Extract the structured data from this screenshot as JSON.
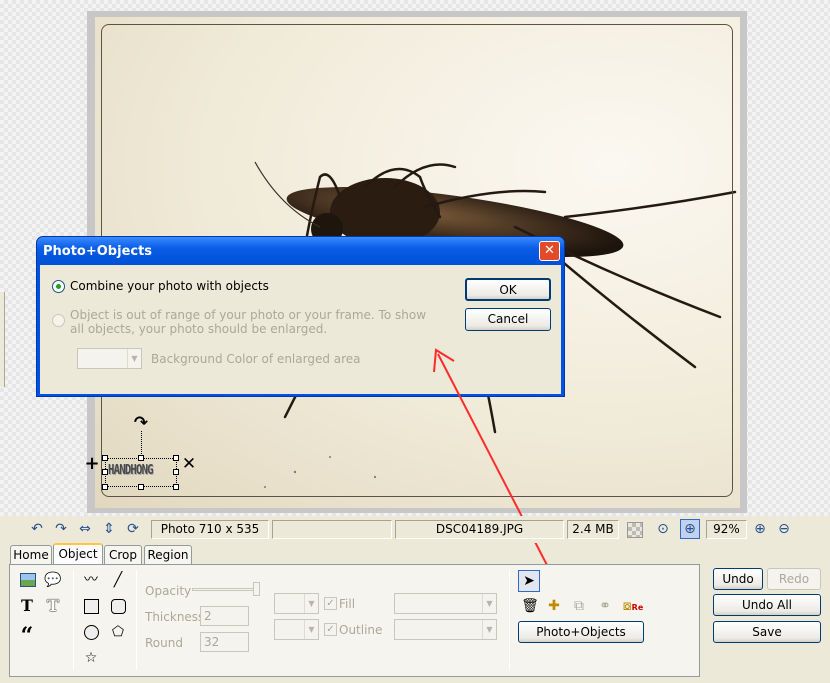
{
  "canvas": {
    "object_text": "HANDHONG"
  },
  "dialog": {
    "title": "Photo+Objects",
    "close_symbol": "✕",
    "option_combine": "Combine your photo with objects",
    "option_enlarge": "Object is out of range of your photo or your frame. To show all objects, your photo should be enlarged.",
    "background_label": "Background Color of enlarged area",
    "ok_label": "OK",
    "cancel_label": "Cancel"
  },
  "statusbar": {
    "photo_size": "Photo 710 x 535",
    "filename": "DSC04189.JPG",
    "file_size": "2.4 MB",
    "zoom": "92%"
  },
  "tabs": [
    {
      "label": "Home"
    },
    {
      "label": "Object"
    },
    {
      "label": "Crop"
    },
    {
      "label": "Region"
    }
  ],
  "object_panel": {
    "opacity_label": "Opacity",
    "thickness_label": "Thickness",
    "thickness_value": "2",
    "round_label": "Round",
    "round_value": "32",
    "fill_label": "Fill",
    "outline_label": "Outline",
    "photo_objects_label": "Photo+Objects",
    "re_badge": "Re"
  },
  "history": {
    "undo_label": "Undo",
    "redo_label": "Redo",
    "undo_all_label": "Undo All",
    "save_label": "Save"
  },
  "colors": {
    "xp_blue": "#0052e5",
    "annotation_arrow": "#ff2a2a",
    "tab_highlight": "#ffc83c"
  }
}
